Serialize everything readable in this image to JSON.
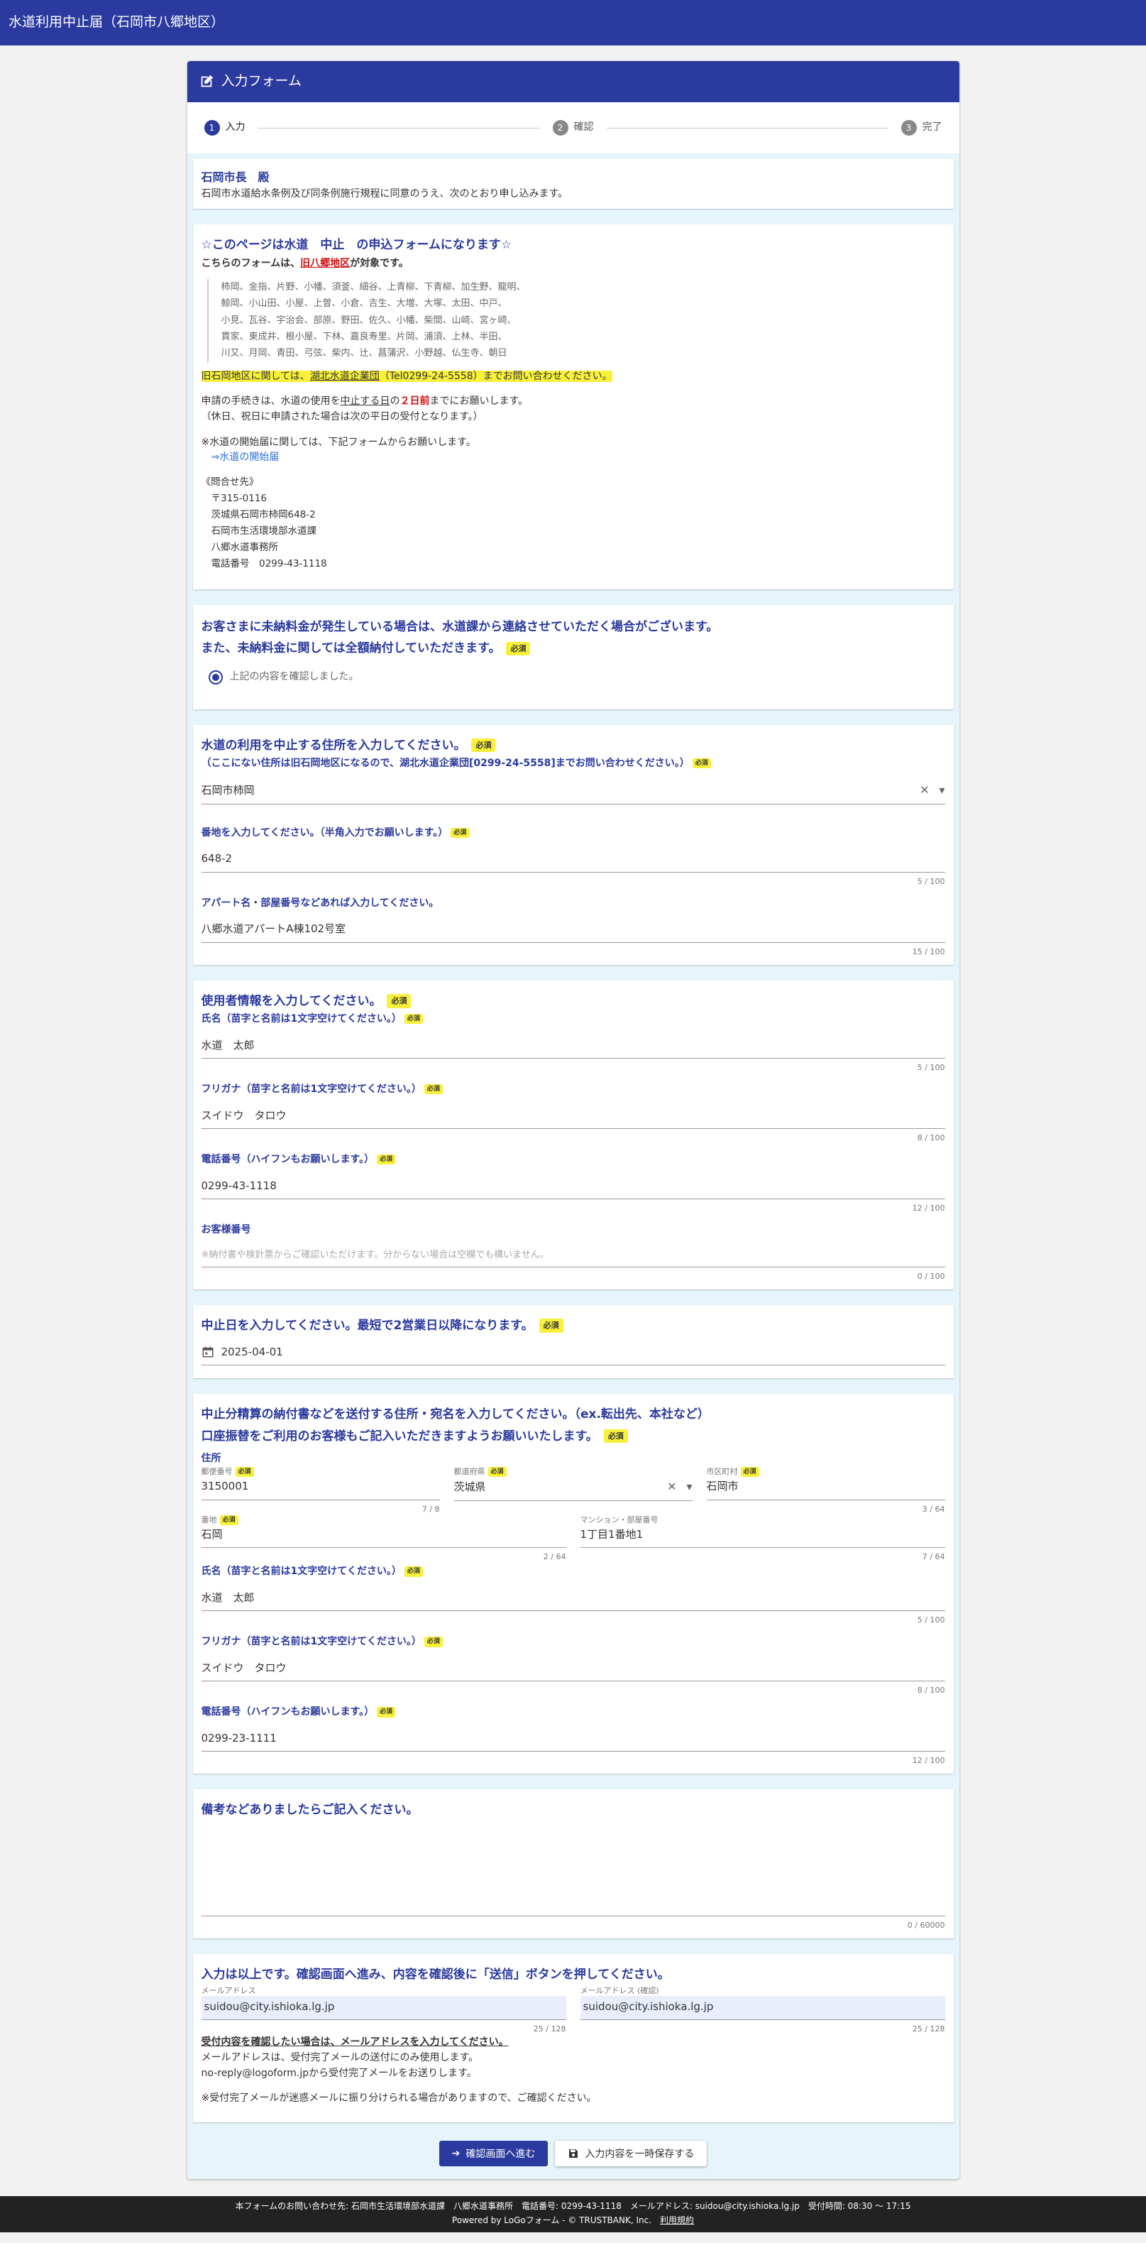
{
  "header": {
    "title": "水道利用中止届（石岡市八郷地区）"
  },
  "form": {
    "title": "入力フォーム"
  },
  "stepper": {
    "steps": [
      {
        "num": "1",
        "label": "入力"
      },
      {
        "num": "2",
        "label": "確認"
      },
      {
        "num": "3",
        "label": "完了"
      }
    ]
  },
  "common": {
    "required": "必須"
  },
  "greeting": {
    "title": "石岡市長　殿",
    "text": "石岡市水道給水条例及び同条例施行規程に同意のうえ、次のとおり申し込みます。"
  },
  "info": {
    "title": "☆このページは水道　中止　の申込フォームになります☆",
    "target_pre": "こちらのフォームは、",
    "target_area": "旧八郷地区",
    "target_post": "が対象です。",
    "areas": [
      "柿岡、金指、片野、小幡、須釜、細谷、上青柳、下青柳、加生野、龍明、",
      "鯨岡、小山田、小屋、上曽、小倉、吉生、大増、大塚、太田、中戸、",
      "小見、瓦谷、宇治会、部原、野田、佐久、小幡、柴間、山崎、宮ヶ崎、",
      "貫家、東成井、根小屋、下林、嘉良寿里、片岡、浦須、上林、半田、",
      "川又、月岡、青田、弓弦、柴内、辻、菖蒲沢、小野越、仏生寺、朝日"
    ],
    "notice_pre": "旧石岡地区に関しては、",
    "notice_org": "湖北水道企業団",
    "notice_post": "（Tel0299-24-5558）までお問い合わせください。",
    "deadline_1": "申請の手続きは、水道の使用を",
    "deadline_2": "中止する日",
    "deadline_3": "の",
    "deadline_4": "２日前",
    "deadline_5": "までにお願いします。",
    "deadline_note": "（休日、祝日に申請された場合は次の平日の受付となります。）",
    "start_note": "※水道の開始届に関しては、下記フォームからお願いします。",
    "start_link": "⇒水道の開始届",
    "contact": [
      "《問合せ先》",
      "〒315-0116",
      "茨城県石岡市柿岡648-2",
      "石岡市生活環境部水道課",
      "八郷水道事務所",
      "電話番号　0299-43-1118"
    ]
  },
  "unpaid": {
    "line1": "お客さまに未納料金が発生している場合は、水道課から連絡させていただく場合がございます。",
    "line2": "また、未納料金に関しては全額納付していただきます。",
    "confirm": "上記の内容を確認しました。"
  },
  "address": {
    "title": "水道の利用を中止する住所を入力してください。",
    "sub": "（ここにない住所は旧石岡地区になるので、湖北水道企業団[0299-24-5558]までお問い合わせください。）",
    "select_value": "石岡市柿岡",
    "lot_label": "番地を入力してください。（半角入力でお願いします。）",
    "lot_value": "648-2",
    "lot_count": "5 / 100",
    "apt_label": "アパート名・部屋番号などあれば入力してください。",
    "apt_value": "八郷水道アパートA棟102号室",
    "apt_count": "15 / 100"
  },
  "user": {
    "title": "使用者情報を入力してください。",
    "name_label": "氏名（苗字と名前は1文字空けてください。）",
    "name_value": "水道　太郎",
    "name_count": "5 / 100",
    "kana_label": "フリガナ（苗字と名前は1文字空けてください。）",
    "kana_value": "スイドウ　タロウ",
    "kana_count": "8 / 100",
    "tel_label": "電話番号（ハイフンもお願いします。）",
    "tel_value": "0299-43-1118",
    "tel_count": "12 / 100",
    "cust_label": "お客様番号",
    "cust_placeholder": "※納付書や検針票からご確認いただけます。分からない場合は空欄でも構いません。",
    "cust_count": "0 / 100"
  },
  "stop_date": {
    "title": "中止日を入力してください。最短で2営業日以降になります。",
    "value": "2025-04-01"
  },
  "billing": {
    "title1": "中止分精算の納付書などを送付する住所・宛名を入力してください。（ex.転出先、本社など）",
    "title2": "口座振替をご利用のお客様もご記入いただきますようお願いいたします。",
    "addr_label": "住所",
    "zip_label": "郵便番号",
    "zip_value": "3150001",
    "zip_count": "7 / 8",
    "pref_label": "都道府県",
    "pref_value": "茨城県",
    "city_label": "市区町村",
    "city_value": "石岡市",
    "city_count": "3 / 64",
    "street_label": "番地",
    "street_value": "石岡",
    "street_count": "2 / 64",
    "bldg_label": "マンション・部屋番号",
    "bldg_value": "1丁目1番地1",
    "bldg_count": "7 / 64",
    "name_label": "氏名（苗字と名前は1文字空けてください。）",
    "name_value": "水道　太郎",
    "name_count": "5 / 100",
    "kana_label": "フリガナ（苗字と名前は1文字空けてください。）",
    "kana_value": "スイドウ　タロウ",
    "kana_count": "8 / 100",
    "tel_label": "電話番号（ハイフンもお願いします。）",
    "tel_value": "0299-23-1111",
    "tel_count": "12 / 100"
  },
  "remarks": {
    "title": "備考などありましたらご記入ください。",
    "count": "0 / 60000"
  },
  "final": {
    "title": "入力は以上です。確認画面へ進み、内容を確認後に「送信」ボタンを押してください。",
    "email_label": "メールアドレス",
    "email_value": "suidou@city.ishioka.lg.jp",
    "email_count": "25 / 128",
    "email_confirm_label": "メールアドレス (確認)",
    "email_confirm_value": "suidou@city.ishioka.lg.jp",
    "email_confirm_count": "25 / 128",
    "note_head": "受付内容を確認したい場合は、メールアドレスを入力してください。",
    "note_1": "メールアドレスは、受付完了メールの送付にのみ使用します。",
    "note_2": "no-reply@logoform.jpから受付完了メールをお送りします。",
    "note_3": "※受付完了メールが迷惑メールに振り分けられる場合がありますので、ご確認ください。"
  },
  "buttons": {
    "next": "確認画面へ進む",
    "save": "入力内容を一時保存する"
  },
  "footer": {
    "contact": "本フォームのお問い合わせ先: 石岡市生活環境部水道課　八郷水道事務所　電話番号: 0299-43-1118　メールアドレス: suidou@city.ishioka.lg.jp　受付時間: 08:30 ～ 17:15",
    "powered": "Powered by LoGoフォーム - © TRUSTBANK, Inc.",
    "terms": "利用規約"
  },
  "colors": {
    "primary": "#2a3a9e",
    "required_bg": "#f8f03a",
    "panel_bg": "#e6f4fb"
  }
}
